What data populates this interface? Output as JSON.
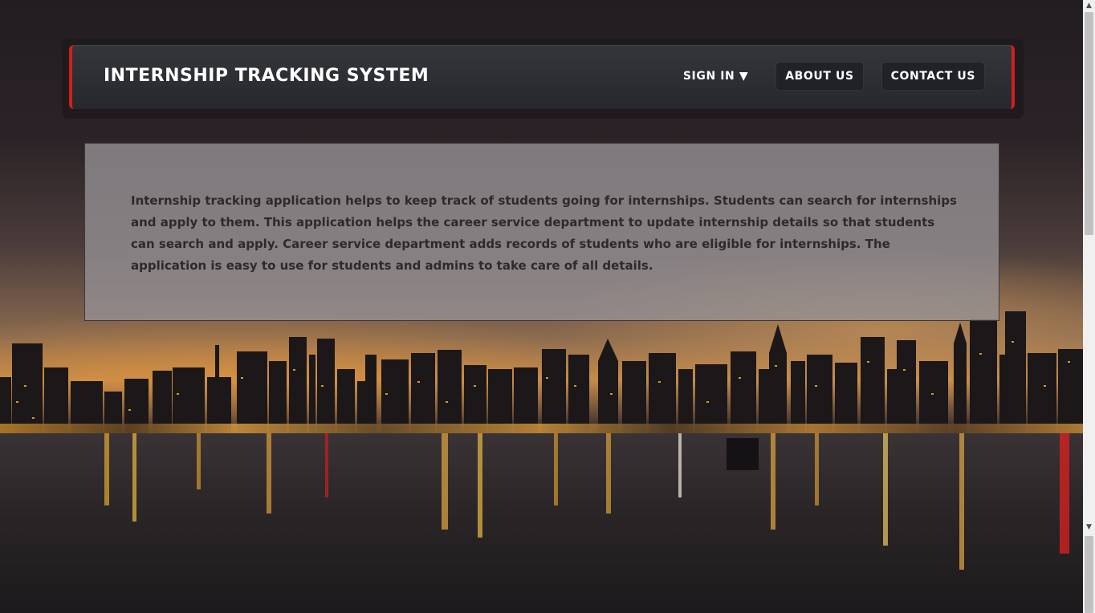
{
  "header": {
    "brand": "INTERNSHIP TRACKING SYSTEM",
    "nav": {
      "sign_in": "SIGN IN ▼",
      "about_us": "ABOUT US",
      "contact_us": "CONTACT US"
    }
  },
  "main": {
    "description": "Internship tracking application helps to keep track of students going for internships. Students can search for internships and apply to them. This application helps the career service department to update internship details so that students can search and apply. Career service department adds records of students who are eligible for internships. The application is easy to use for students and admins to take care of all details."
  },
  "background": {
    "scene": "city-skyline-at-night-over-water"
  },
  "colors": {
    "accent": "#d0201c",
    "header_bg": "#2e3035",
    "panel_text": "#2e2a2c"
  },
  "icons": {
    "scroll_up": "▲",
    "scroll_down": "▼"
  }
}
